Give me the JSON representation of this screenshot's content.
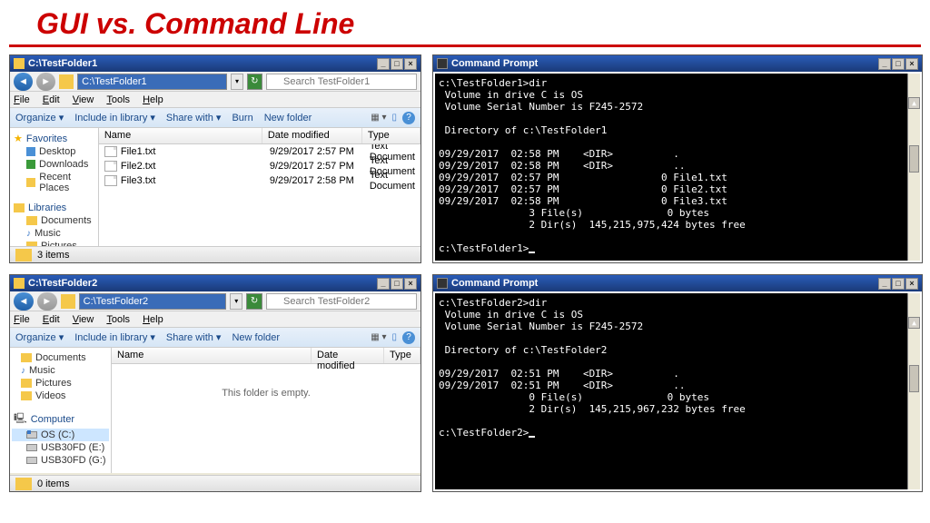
{
  "slide_title": "GUI vs. Command Line",
  "explorer1": {
    "title": "C:\\TestFolder1",
    "address": "C:\\TestFolder1",
    "search_placeholder": "Search TestFolder1",
    "menu": {
      "file": "File",
      "edit": "Edit",
      "view": "View",
      "tools": "Tools",
      "help": "Help"
    },
    "toolbar": {
      "organize": "Organize ▾",
      "include": "Include in library ▾",
      "share": "Share with ▾",
      "burn": "Burn",
      "newfolder": "New folder"
    },
    "sidebar": {
      "fav": "Favorites",
      "desktop": "Desktop",
      "downloads": "Downloads",
      "recent": "Recent Places",
      "lib": "Libraries",
      "docs": "Documents",
      "music": "Music",
      "pics": "Pictures"
    },
    "cols": {
      "name": "Name",
      "date": "Date modified",
      "type": "Type"
    },
    "files": [
      {
        "name": "File1.txt",
        "date": "9/29/2017 2:57 PM",
        "type": "Text Document"
      },
      {
        "name": "File2.txt",
        "date": "9/29/2017 2:57 PM",
        "type": "Text Document"
      },
      {
        "name": "File3.txt",
        "date": "9/29/2017 2:58 PM",
        "type": "Text Document"
      }
    ],
    "status": "3 items"
  },
  "explorer2": {
    "title": "C:\\TestFolder2",
    "address": "C:\\TestFolder2",
    "search_placeholder": "Search TestFolder2",
    "menu": {
      "file": "File",
      "edit": "Edit",
      "view": "View",
      "tools": "Tools",
      "help": "Help"
    },
    "toolbar": {
      "organize": "Organize ▾",
      "include": "Include in library ▾",
      "share": "Share with ▾",
      "newfolder": "New folder"
    },
    "sidebar": {
      "docs": "Documents",
      "music": "Music",
      "pics": "Pictures",
      "videos": "Videos",
      "comp": "Computer",
      "osc": "OS (C:)",
      "usb_e": "USB30FD (E:)",
      "usb_g": "USB30FD (G:)"
    },
    "cols": {
      "name": "Name",
      "date": "Date modified",
      "type": "Type"
    },
    "empty": "This folder is empty.",
    "status": "0 items"
  },
  "cmd1": {
    "title": "Command Prompt",
    "text": "c:\\TestFolder1>dir\n Volume in drive C is OS\n Volume Serial Number is F245-2572\n\n Directory of c:\\TestFolder1\n\n09/29/2017  02:58 PM    <DIR>          .\n09/29/2017  02:58 PM    <DIR>          ..\n09/29/2017  02:57 PM                 0 File1.txt\n09/29/2017  02:57 PM                 0 File2.txt\n09/29/2017  02:58 PM                 0 File3.txt\n               3 File(s)              0 bytes\n               2 Dir(s)  145,215,975,424 bytes free\n\nc:\\TestFolder1>"
  },
  "cmd2": {
    "title": "Command Prompt",
    "text": "c:\\TestFolder2>dir\n Volume in drive C is OS\n Volume Serial Number is F245-2572\n\n Directory of c:\\TestFolder2\n\n09/29/2017  02:51 PM    <DIR>          .\n09/29/2017  02:51 PM    <DIR>          ..\n               0 File(s)              0 bytes\n               2 Dir(s)  145,215,967,232 bytes free\n\nc:\\TestFolder2>"
  }
}
